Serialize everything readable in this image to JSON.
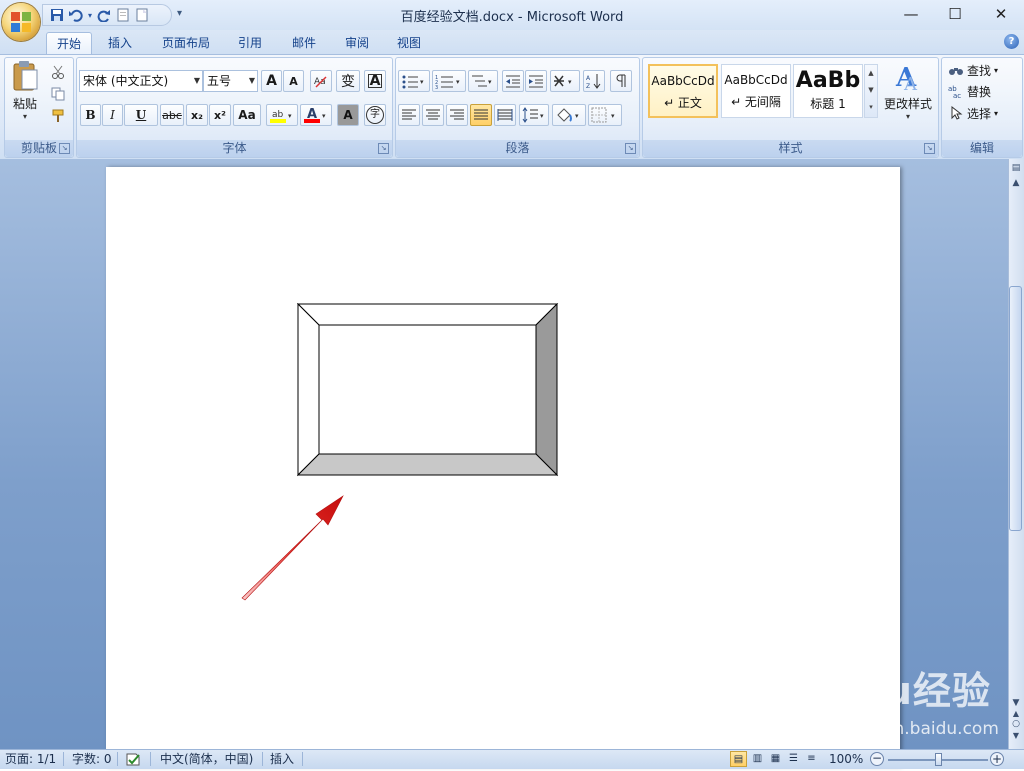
{
  "window": {
    "title": "百度经验文档.docx - Microsoft Word",
    "minimize": "—",
    "maximize": "☐",
    "close": "✕"
  },
  "quick_access": {
    "icons": [
      "save-icon",
      "undo-icon",
      "redo-icon",
      "new-doc-icon",
      "open-doc-icon"
    ],
    "more": "▾"
  },
  "tabs": [
    {
      "label": "开始",
      "active": true
    },
    {
      "label": "插入",
      "active": false
    },
    {
      "label": "页面布局",
      "active": false
    },
    {
      "label": "引用",
      "active": false
    },
    {
      "label": "邮件",
      "active": false
    },
    {
      "label": "审阅",
      "active": false
    },
    {
      "label": "视图",
      "active": false
    }
  ],
  "help": "?",
  "ribbon": {
    "clipboard": {
      "label": "剪贴板",
      "paste": "粘贴"
    },
    "font": {
      "label": "字体",
      "font_name": "宋体 (中文正文)",
      "font_size": "五号",
      "bold": "B",
      "italic": "I",
      "underline": "U",
      "strike": "abc",
      "subscript": "x₂",
      "superscript": "x²",
      "change_case": "Aa",
      "grow": "A",
      "shrink": "A",
      "phonetic": "变",
      "border_char": "A",
      "shade_char": "A",
      "enclose": "字"
    },
    "paragraph": {
      "label": "段落"
    },
    "styles": {
      "label": "样式",
      "items": [
        {
          "sample": "AaBbCcDd",
          "name": "↵ 正文",
          "active": true
        },
        {
          "sample": "AaBbCcDd",
          "name": "↵ 无间隔",
          "active": false
        },
        {
          "sample": "AaBb",
          "name": "标题 1",
          "active": false
        }
      ],
      "change_styles": "更改样式"
    },
    "editing": {
      "label": "编辑",
      "find": "查找",
      "replace": "替换",
      "select": "选择"
    }
  },
  "status": {
    "page": "页面: 1/1",
    "words": "字数: 0",
    "language": "中文(简体，中国)",
    "mode": "插入",
    "zoom": "100%"
  },
  "watermark": {
    "text": "Baidu经验",
    "url": "jingyan.baidu.com"
  },
  "colors": {
    "highlight": "#ffff00",
    "font_color": "#ff0000",
    "accent": "#15428b"
  }
}
